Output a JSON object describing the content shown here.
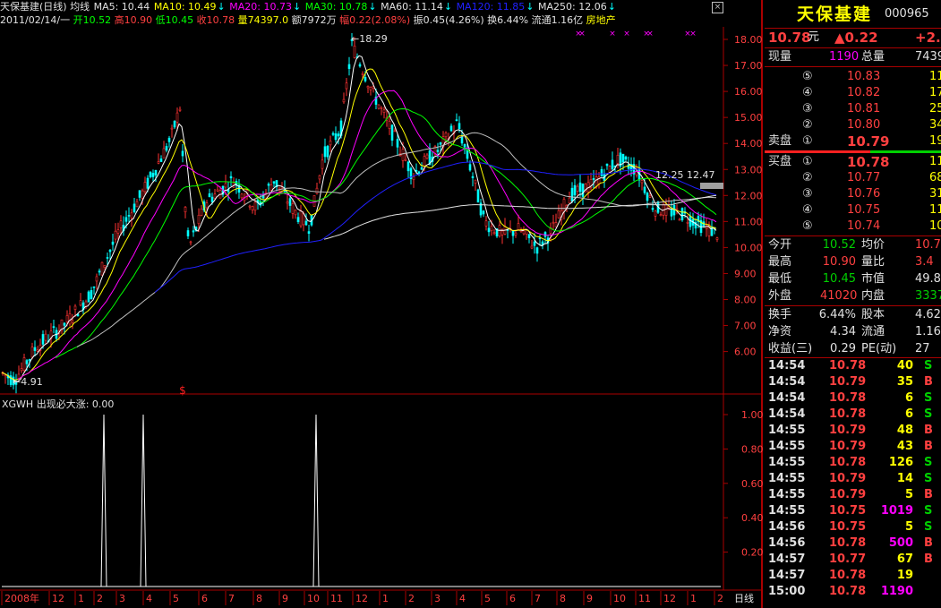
{
  "header": {
    "title": "天保基建(日线) 均线",
    "ma5": "MA5: 10.44",
    "ma10": "MA10: 10.49",
    "ma20": "MA20: 10.73",
    "ma30": "MA30: 10.78",
    "ma60": "MA60: 11.14",
    "ma120": "MA120: 11.85",
    "ma250": "MA250: 12.06",
    "date": "2011/02/14/一",
    "open": "开10.52",
    "high": "高10.90",
    "low": "低10.45",
    "close": "收10.78",
    "volume": "量74397.0",
    "amount": "额7972万",
    "change": "幅0.22(2.08%)",
    "amplitude": "振0.45(4.26%)",
    "turnover": "换6.44%",
    "float": "流通1.16亿",
    "sector": "房地产",
    "close_icon": "close-icon"
  },
  "price_axis": [
    "18.00",
    "17.00",
    "16.00",
    "15.00",
    "14.00",
    "13.00",
    "12.00",
    "11.00",
    "10.00",
    "9.00",
    "8.00",
    "7.00",
    "6.00"
  ],
  "annotations": {
    "high": "18.29",
    "low": "4.91",
    "ma_tag": "12.25 12.47",
    "signal": "$"
  },
  "indicator": {
    "title": "XGWH 出现必大涨: 0.00",
    "axis": [
      "1.00",
      "0.80",
      "0.60",
      "0.40",
      "0.20"
    ]
  },
  "time_axis": {
    "labels": [
      "2008年",
      "12",
      "1",
      "2",
      "3",
      "4",
      "5",
      "6",
      "7",
      "8",
      "9",
      "10",
      "11",
      "12",
      "1",
      "2",
      "3",
      "4",
      "5",
      "6",
      "7",
      "8",
      "9",
      "10",
      "11",
      "12",
      "1",
      "2"
    ],
    "period": "日线"
  },
  "chart_data": {
    "type": "candlestick",
    "title": "天保基建(日线)",
    "ylim": [
      4.5,
      18.6
    ],
    "key_points": [
      {
        "label": "low",
        "value": 4.91
      },
      {
        "label": "high",
        "value": 18.29
      },
      {
        "label": "last",
        "value": 10.78
      }
    ],
    "indicator_series": {
      "name": "XGWH",
      "signals": [
        1,
        1,
        1
      ],
      "ylim": [
        0,
        1.1
      ]
    }
  },
  "quote": {
    "name": "天保基建",
    "code": "000965",
    "price": "10.78",
    "unit": "元",
    "change": "▲0.22",
    "pct": "+2.",
    "cur_vol_label": "现量",
    "cur_vol": "1190",
    "tot_vol_label": "总量",
    "tot_vol": "7439",
    "sells": [
      {
        "no": "⑤",
        "price": "10.83",
        "vol": "11"
      },
      {
        "no": "④",
        "price": "10.82",
        "vol": "17"
      },
      {
        "no": "③",
        "price": "10.81",
        "vol": "25"
      },
      {
        "no": "②",
        "price": "10.80",
        "vol": "34"
      },
      {
        "no": "①",
        "price": "10.79",
        "vol": "19",
        "label": "卖盘"
      }
    ],
    "buys": [
      {
        "no": "①",
        "price": "10.78",
        "vol": "11",
        "label": "买盘"
      },
      {
        "no": "②",
        "price": "10.77",
        "vol": "68"
      },
      {
        "no": "③",
        "price": "10.76",
        "vol": "31"
      },
      {
        "no": "④",
        "price": "10.75",
        "vol": "11"
      },
      {
        "no": "⑤",
        "price": "10.74",
        "vol": "10"
      }
    ],
    "stats": [
      {
        "l1": "今开",
        "v1": "10.52",
        "c1": "#00d000",
        "l2": "均价",
        "v2": "10.7",
        "c2": "#ff4040"
      },
      {
        "l1": "最高",
        "v1": "10.90",
        "c1": "#ff4040",
        "l2": "量比",
        "v2": "3.4",
        "c2": "#ff4040"
      },
      {
        "l1": "最低",
        "v1": "10.45",
        "c1": "#00d000",
        "l2": "市值",
        "v2": "49.81",
        "c2": "#e0e0e0"
      },
      {
        "l1": "外盘",
        "v1": "41020",
        "c1": "#ff4040",
        "l2": "内盘",
        "v2": "3337",
        "c2": "#00d000"
      }
    ],
    "stats2": [
      {
        "l1": "换手",
        "v1": "6.44%",
        "l2": "股本",
        "v2": "4.62"
      },
      {
        "l1": "净资",
        "v1": "4.34",
        "l2": "流通",
        "v2": "1.16"
      },
      {
        "l1": "收益(三)",
        "v1": "0.29",
        "l2": "PE(动)",
        "v2": "27"
      }
    ],
    "trades": [
      {
        "t": "14:54",
        "p": "10.78",
        "v": "40",
        "s": "S"
      },
      {
        "t": "14:54",
        "p": "10.79",
        "v": "35",
        "s": "B"
      },
      {
        "t": "14:54",
        "p": "10.78",
        "v": "6",
        "s": "S"
      },
      {
        "t": "14:54",
        "p": "10.78",
        "v": "6",
        "s": "S"
      },
      {
        "t": "14:55",
        "p": "10.79",
        "v": "48",
        "s": "B"
      },
      {
        "t": "14:55",
        "p": "10.79",
        "v": "43",
        "s": "B"
      },
      {
        "t": "14:55",
        "p": "10.78",
        "v": "126",
        "s": "S"
      },
      {
        "t": "14:55",
        "p": "10.79",
        "v": "14",
        "s": "S"
      },
      {
        "t": "14:55",
        "p": "10.79",
        "v": "5",
        "s": "B"
      },
      {
        "t": "14:55",
        "p": "10.75",
        "v": "1019",
        "s": "S"
      },
      {
        "t": "14:56",
        "p": "10.75",
        "v": "5",
        "s": "S"
      },
      {
        "t": "14:56",
        "p": "10.78",
        "v": "500",
        "s": "B"
      },
      {
        "t": "14:57",
        "p": "10.77",
        "v": "67",
        "s": "B"
      },
      {
        "t": "14:57",
        "p": "10.78",
        "v": "19",
        "s": ""
      },
      {
        "t": "15:00",
        "p": "10.78",
        "v": "1190",
        "s": ""
      }
    ]
  }
}
